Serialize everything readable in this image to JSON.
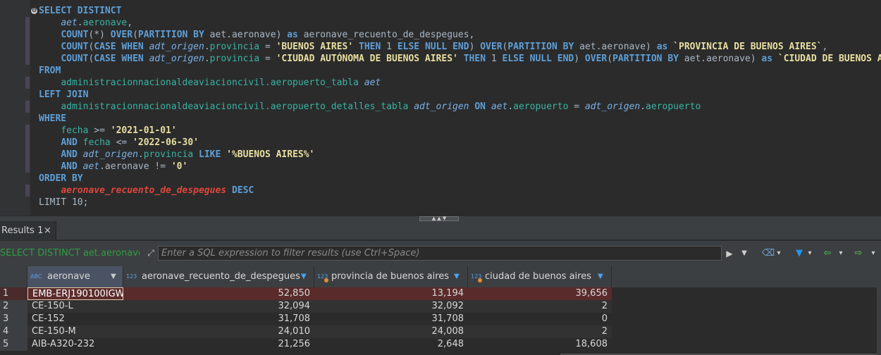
{
  "editor": {
    "lines": [
      [
        [
          "kw",
          "SELECT DISTINCT"
        ]
      ],
      [
        [
          "txt",
          "    "
        ],
        [
          "alias",
          "aet"
        ],
        [
          "txt",
          "."
        ],
        [
          "col",
          "aeronave"
        ],
        [
          "txt",
          ","
        ]
      ],
      [
        [
          "txt",
          "    "
        ],
        [
          "kw",
          "COUNT"
        ],
        [
          "txt",
          "(*) "
        ],
        [
          "kw",
          "OVER"
        ],
        [
          "txt",
          "("
        ],
        [
          "kw",
          "PARTITION BY"
        ],
        [
          "txt",
          " aet.aeronave) "
        ],
        [
          "kw",
          "as"
        ],
        [
          "txt",
          " aeronave_recuento_de_despegues,"
        ]
      ],
      [
        [
          "txt",
          "    "
        ],
        [
          "kw",
          "COUNT"
        ],
        [
          "txt",
          "("
        ],
        [
          "kw",
          "CASE WHEN"
        ],
        [
          "txt",
          " "
        ],
        [
          "alias",
          "adt_origen"
        ],
        [
          "txt",
          "."
        ],
        [
          "col",
          "provincia"
        ],
        [
          "txt",
          " = "
        ],
        [
          "str",
          "'BUENOS AIRES'"
        ],
        [
          "txt",
          " "
        ],
        [
          "kw",
          "THEN"
        ],
        [
          "txt",
          " 1 "
        ],
        [
          "kw",
          "ELSE NULL END"
        ],
        [
          "txt",
          ") "
        ],
        [
          "kw",
          "OVER"
        ],
        [
          "txt",
          "("
        ],
        [
          "kw",
          "PARTITION BY"
        ],
        [
          "txt",
          " aet.aeronave) "
        ],
        [
          "kw",
          "as"
        ],
        [
          "txt",
          " "
        ],
        [
          "str",
          "`PROVINCIA DE BUENOS AIRES`"
        ],
        [
          "txt",
          ","
        ]
      ],
      [
        [
          "txt",
          "    "
        ],
        [
          "kw",
          "COUNT"
        ],
        [
          "txt",
          "("
        ],
        [
          "kw",
          "CASE WHEN"
        ],
        [
          "txt",
          " "
        ],
        [
          "alias",
          "adt_origen"
        ],
        [
          "txt",
          "."
        ],
        [
          "col",
          "provincia"
        ],
        [
          "txt",
          " = "
        ],
        [
          "str",
          "'CIUDAD AUTÓNOMA DE BUENOS AIRES'"
        ],
        [
          "txt",
          " "
        ],
        [
          "kw",
          "THEN"
        ],
        [
          "txt",
          " 1 "
        ],
        [
          "kw",
          "ELSE NULL END"
        ],
        [
          "txt",
          ") "
        ],
        [
          "kw",
          "OVER"
        ],
        [
          "txt",
          "("
        ],
        [
          "kw",
          "PARTITION BY"
        ],
        [
          "txt",
          " aet.aeronave) "
        ],
        [
          "kw",
          "as"
        ],
        [
          "txt",
          " "
        ],
        [
          "str",
          "`CIUDAD DE BUENOS AIRES`"
        ]
      ],
      [
        [
          "kw",
          "FROM"
        ]
      ],
      [
        [
          "txt",
          "    "
        ],
        [
          "col",
          "administracionnacionaldeaviacioncivil.aeropuerto_tabla"
        ],
        [
          "txt",
          " "
        ],
        [
          "alias",
          "aet"
        ]
      ],
      [
        [
          "kw",
          "LEFT JOIN"
        ]
      ],
      [
        [
          "txt",
          "    "
        ],
        [
          "col",
          "administracionnacionaldeaviacioncivil.aeropuerto_detalles_tabla"
        ],
        [
          "txt",
          " "
        ],
        [
          "alias",
          "adt_origen"
        ],
        [
          "txt",
          " "
        ],
        [
          "kw",
          "ON"
        ],
        [
          "txt",
          " "
        ],
        [
          "alias",
          "aet"
        ],
        [
          "txt",
          "."
        ],
        [
          "col",
          "aeropuerto"
        ],
        [
          "txt",
          " = "
        ],
        [
          "alias",
          "adt_origen"
        ],
        [
          "txt",
          "."
        ],
        [
          "col",
          "aeropuerto"
        ]
      ],
      [
        [
          "kw",
          "WHERE"
        ]
      ],
      [
        [
          "txt",
          "    "
        ],
        [
          "col",
          "fecha"
        ],
        [
          "txt",
          " >= "
        ],
        [
          "str",
          "'2021-01-01'"
        ]
      ],
      [
        [
          "txt",
          "    "
        ],
        [
          "kw",
          "AND"
        ],
        [
          "txt",
          " "
        ],
        [
          "col",
          "fecha"
        ],
        [
          "txt",
          " <= "
        ],
        [
          "str",
          "'2022-06-30'"
        ]
      ],
      [
        [
          "txt",
          "    "
        ],
        [
          "kw",
          "AND"
        ],
        [
          "txt",
          " "
        ],
        [
          "alias",
          "adt_origen"
        ],
        [
          "txt",
          "."
        ],
        [
          "col",
          "provincia"
        ],
        [
          "txt",
          " "
        ],
        [
          "kw",
          "LIKE"
        ],
        [
          "txt",
          " "
        ],
        [
          "str",
          "'%BUENOS AIRES%'"
        ]
      ],
      [
        [
          "txt",
          "    "
        ],
        [
          "kw",
          "AND"
        ],
        [
          "txt",
          " "
        ],
        [
          "alias",
          "aet"
        ],
        [
          "txt",
          ".aeronave != "
        ],
        [
          "str",
          "'0'"
        ]
      ],
      [
        [
          "kw",
          "ORDER BY"
        ]
      ],
      [
        [
          "txt",
          "    "
        ],
        [
          "red",
          "aeronave_recuento_de_despegues"
        ],
        [
          "txt",
          " "
        ],
        [
          "kw",
          "DESC"
        ]
      ],
      [
        [
          "txt",
          "LIMIT 10;"
        ]
      ]
    ],
    "fold_icon": "⊖"
  },
  "splitter": {
    "handle_icon": "chevron-up-down-icon",
    "glyph": "▲ ▲ ▼"
  },
  "results_tab": {
    "label": "Results 1",
    "close_glyph": "×"
  },
  "filter_bar": {
    "query_label": "SELECT DISTINCT aet.aeronave,",
    "placeholder": "Enter a SQL expression to filter results (use Ctrl+Space)",
    "expand_glyph": "⤢",
    "apply_glyph": "▶",
    "history_glyph": "▼",
    "erase_glyph": "⌫",
    "dropdown_glyph": "▾",
    "funnel_glyph": "▼",
    "back_glyph": "⇦",
    "forward_glyph": "⇨"
  },
  "grid": {
    "columns": [
      {
        "type_icon": "ABC",
        "label": "aeronave"
      },
      {
        "type_icon": "123",
        "label": "aeronave_recuento_de_despegues"
      },
      {
        "type_icon": "123",
        "label": "provincia de buenos aires"
      },
      {
        "type_icon": "123",
        "label": "ciudad de buenos aires"
      }
    ],
    "sort_glyph": "▼",
    "rows": [
      {
        "n": "1",
        "aeronave": "EMB-ERJ190100IGW",
        "recuento": "52,850",
        "provincia": "13,194",
        "ciudad": "39,656"
      },
      {
        "n": "2",
        "aeronave": "CE-150-L",
        "recuento": "32,094",
        "provincia": "32,092",
        "ciudad": "2"
      },
      {
        "n": "3",
        "aeronave": "CE-152",
        "recuento": "31,708",
        "provincia": "31,708",
        "ciudad": "0"
      },
      {
        "n": "4",
        "aeronave": "CE-150-M",
        "recuento": "24,010",
        "provincia": "24,008",
        "ciudad": "2"
      },
      {
        "n": "5",
        "aeronave": "AIB-A320-232",
        "recuento": "21,256",
        "provincia": "2,648",
        "ciudad": "18,608"
      }
    ]
  },
  "colors": {
    "keyword": "#5e9fd8",
    "alias": "#7ab0e6",
    "column": "#39b3a4",
    "string": "#e8dfa0",
    "highlight": "#e0463a",
    "query_label": "#2e9d42"
  }
}
